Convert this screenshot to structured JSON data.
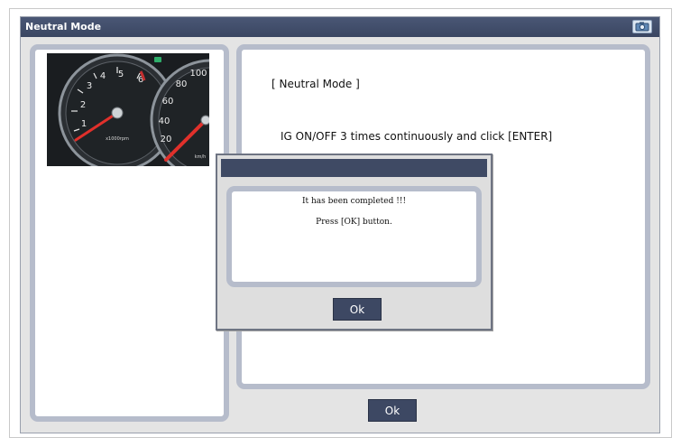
{
  "window": {
    "title": "Neutral Mode",
    "camera_icon": "camera-icon"
  },
  "main": {
    "heading": "[ Neutral Mode ]",
    "instruction": "IG ON/OFF 3 times continuously and click [ENTER]",
    "ok_label": "Ok"
  },
  "gauge": {
    "tach_numbers": [
      "1",
      "2",
      "3",
      "4",
      "5",
      "6"
    ],
    "tach_unit": "x1000rpm",
    "speed_numbers": [
      "20",
      "40",
      "60",
      "80",
      "100"
    ],
    "speed_unit": "km/h"
  },
  "dialog": {
    "title": "",
    "message_line1": "It has been completed !!!",
    "message_line2": "Press [OK] button.",
    "ok_label": "Ok"
  },
  "colors": {
    "titlebar": "#3d4863",
    "panel_border": "#b6bccb",
    "window_bg": "#e4e4e4",
    "button_bg": "#3d4863",
    "needle": "#d42a2a"
  }
}
